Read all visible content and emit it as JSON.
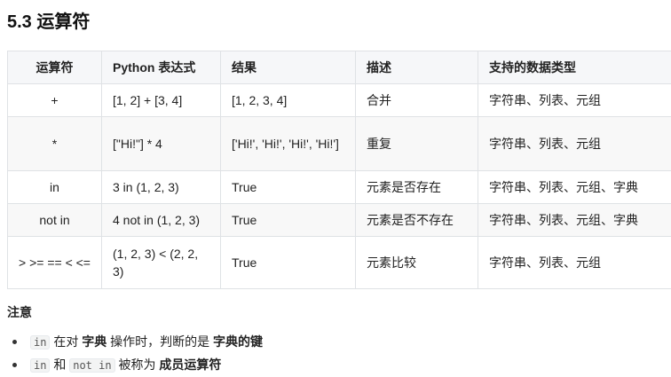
{
  "heading": "5.3 运算符",
  "table": {
    "headers": [
      "运算符",
      "Python 表达式",
      "结果",
      "描述",
      "支持的数据类型"
    ],
    "rows": [
      [
        "+",
        "[1, 2] + [3, 4]",
        "[1, 2, 3, 4]",
        "合并",
        "字符串、列表、元组"
      ],
      [
        "*",
        "[\"Hi!\"] * 4",
        "['Hi!', 'Hi!', 'Hi!', 'Hi!']",
        "重复",
        "字符串、列表、元组"
      ],
      [
        "in",
        "3 in (1, 2, 3)",
        "True",
        "元素是否存在",
        "字符串、列表、元组、字典"
      ],
      [
        "not in",
        "4 not in (1, 2, 3)",
        "True",
        "元素是否不存在",
        "字符串、列表、元组、字典"
      ],
      [
        "> >= == < <=",
        "(1, 2, 3) < (2, 2, 3)",
        "True",
        "元素比较",
        "字符串、列表、元组"
      ]
    ]
  },
  "note": {
    "title": "注意",
    "item1": {
      "code": "in",
      "t1": "在对",
      "b1": "字典",
      "t2": "操作时，判断的是",
      "b2": "字典的键"
    },
    "item2": {
      "code1": "in",
      "t1": "和",
      "code2": "not in",
      "t2": "被称为",
      "b1": "成员运算符"
    }
  }
}
